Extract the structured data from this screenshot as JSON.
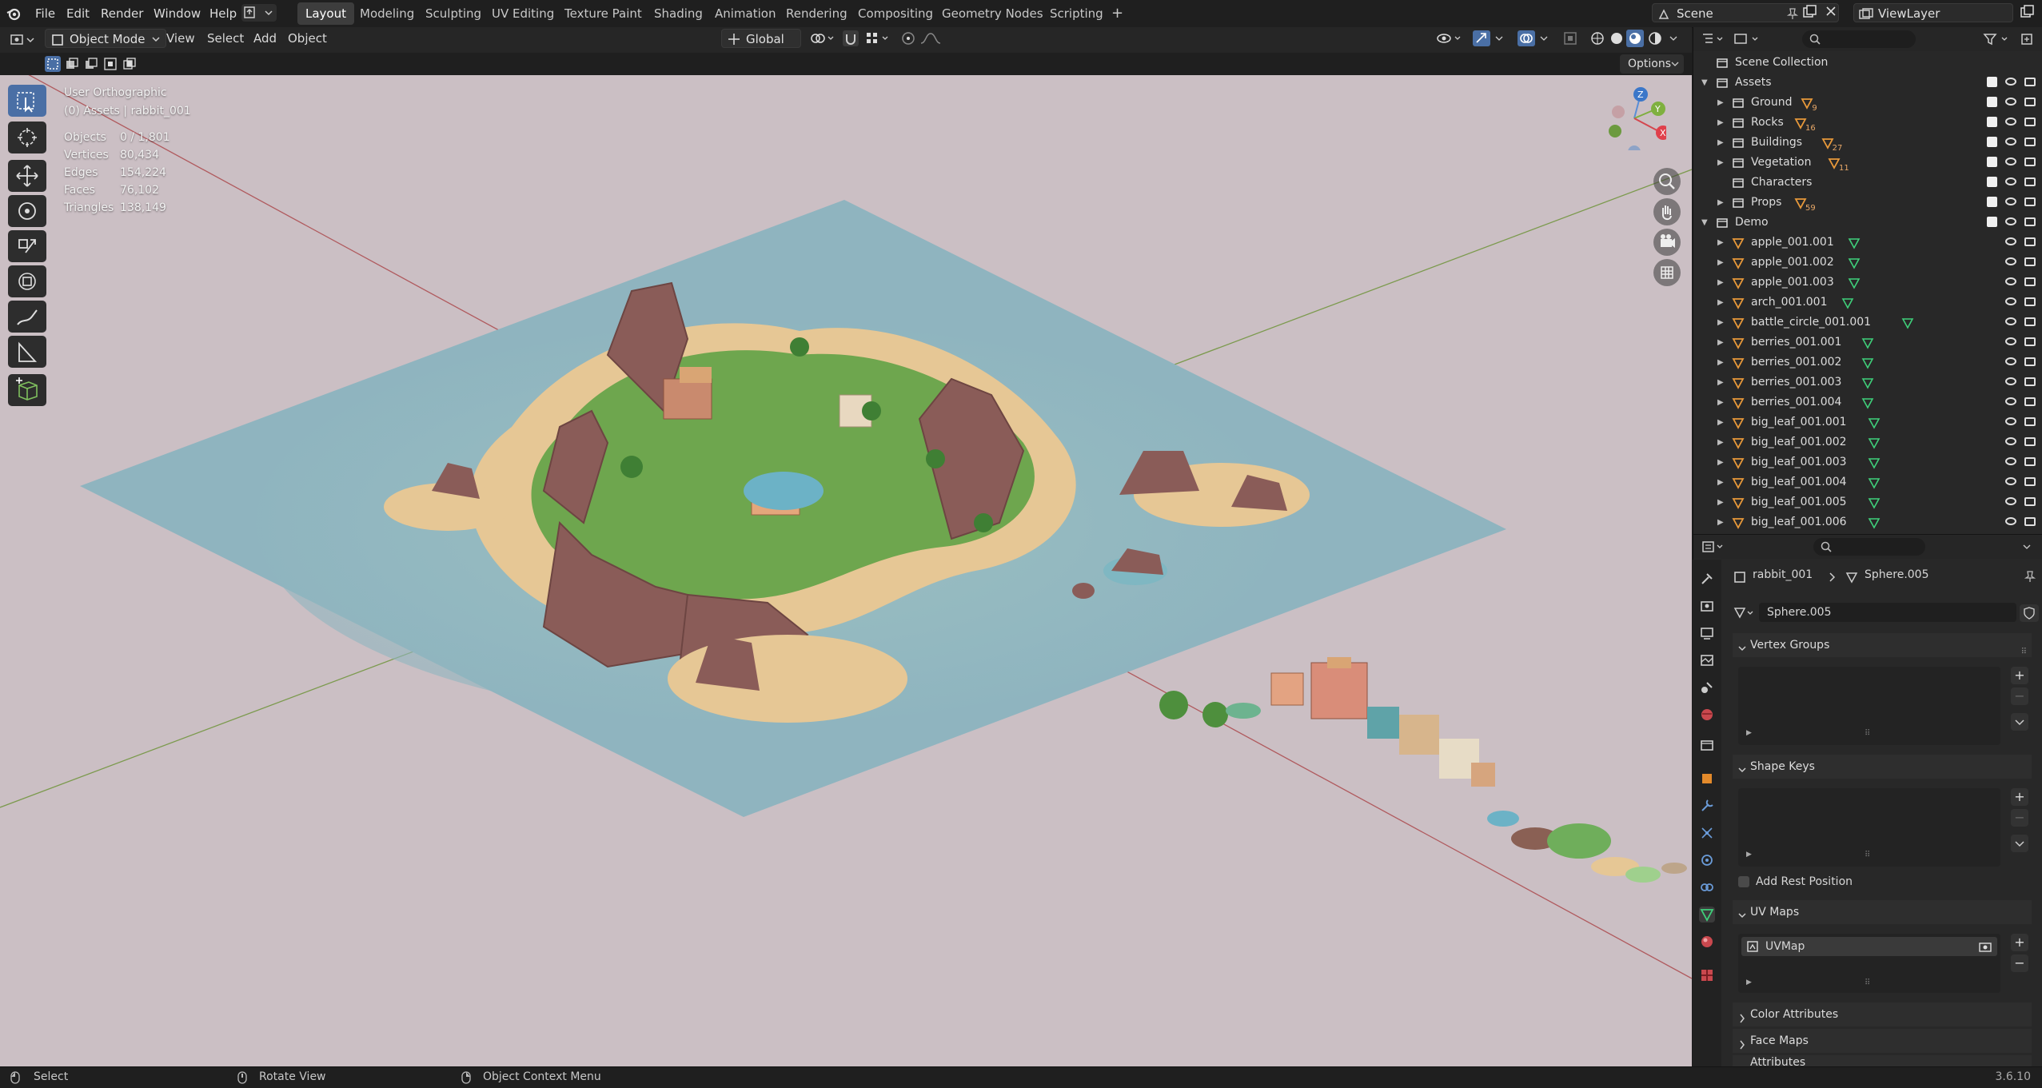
{
  "topbar": {
    "menus": [
      "File",
      "Edit",
      "Render",
      "Window",
      "Help"
    ],
    "workspaces": [
      "Layout",
      "Modeling",
      "Sculpting",
      "UV Editing",
      "Texture Paint",
      "Shading",
      "Animation",
      "Rendering",
      "Compositing",
      "Geometry Nodes",
      "Scripting"
    ],
    "active_workspace": "Layout",
    "add_workspace": "+",
    "scene": "Scene",
    "view_layer": "ViewLayer"
  },
  "viewport_header": {
    "mode": "Object Mode",
    "menus": [
      "View",
      "Select",
      "Add",
      "Object"
    ],
    "orientation": "Global",
    "options": "Options"
  },
  "viewport": {
    "view_name": "User Orthographic",
    "context": "(0) Assets | rabbit_001",
    "stats": [
      {
        "label": "Objects",
        "value": "0 / 1,801"
      },
      {
        "label": "Vertices",
        "value": "80,434"
      },
      {
        "label": "Edges",
        "value": "154,224"
      },
      {
        "label": "Faces",
        "value": "76,102"
      },
      {
        "label": "Triangles",
        "value": "138,149"
      }
    ],
    "gizmo": {
      "z": "Z",
      "y": "Y",
      "x": "X"
    }
  },
  "outliner": {
    "root": "Scene Collection",
    "rows": [
      {
        "label": "Assets",
        "depth": 1,
        "expanded": true,
        "type": "collection",
        "count": ""
      },
      {
        "label": "Ground",
        "depth": 2,
        "type": "collection",
        "count": "9"
      },
      {
        "label": "Rocks",
        "depth": 2,
        "type": "collection",
        "count": "16"
      },
      {
        "label": "Buildings",
        "depth": 2,
        "type": "collection",
        "count": "27"
      },
      {
        "label": "Vegetation",
        "depth": 2,
        "type": "collection",
        "count": "11"
      },
      {
        "label": "Characters",
        "depth": 2,
        "type": "collection",
        "count": ""
      },
      {
        "label": "Props",
        "depth": 2,
        "type": "collection",
        "count": "59"
      },
      {
        "label": "Demo",
        "depth": 1,
        "expanded": true,
        "type": "collection",
        "count": ""
      },
      {
        "label": "apple_001.001",
        "depth": 2,
        "type": "mesh"
      },
      {
        "label": "apple_001.002",
        "depth": 2,
        "type": "mesh"
      },
      {
        "label": "apple_001.003",
        "depth": 2,
        "type": "mesh"
      },
      {
        "label": "arch_001.001",
        "depth": 2,
        "type": "mesh"
      },
      {
        "label": "battle_circle_001.001",
        "depth": 2,
        "type": "mesh"
      },
      {
        "label": "berries_001.001",
        "depth": 2,
        "type": "mesh"
      },
      {
        "label": "berries_001.002",
        "depth": 2,
        "type": "mesh"
      },
      {
        "label": "berries_001.003",
        "depth": 2,
        "type": "mesh"
      },
      {
        "label": "berries_001.004",
        "depth": 2,
        "type": "mesh"
      },
      {
        "label": "big_leaf_001.001",
        "depth": 2,
        "type": "mesh"
      },
      {
        "label": "big_leaf_001.002",
        "depth": 2,
        "type": "mesh"
      },
      {
        "label": "big_leaf_001.003",
        "depth": 2,
        "type": "mesh"
      },
      {
        "label": "big_leaf_001.004",
        "depth": 2,
        "type": "mesh"
      },
      {
        "label": "big_leaf_001.005",
        "depth": 2,
        "type": "mesh"
      },
      {
        "label": "big_leaf_001.006",
        "depth": 2,
        "type": "mesh"
      }
    ]
  },
  "properties": {
    "breadcrumb_object": "rabbit_001",
    "breadcrumb_data": "Sphere.005",
    "data_name": "Sphere.005",
    "panels": {
      "vertex_groups": "Vertex Groups",
      "shape_keys": "Shape Keys",
      "add_rest_position": "Add Rest Position",
      "uv_maps": "UV Maps",
      "uv_map_item": "UVMap",
      "color_attributes": "Color Attributes",
      "face_maps": "Face Maps",
      "attributes": "Attributes"
    }
  },
  "statusbar": {
    "select": "Select",
    "rotate": "Rotate View",
    "context_menu": "Object Context Menu",
    "version": "3.6.10"
  },
  "colors": {
    "viewport_bg": "#cbbfc4",
    "water": "#8fb5bf",
    "sand": "#e6c795",
    "rock": "#8a5c58",
    "grass": "#5e9a44",
    "accent": "#4a6fa5"
  }
}
